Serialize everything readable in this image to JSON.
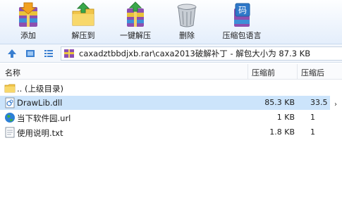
{
  "toolbar": {
    "buttons": [
      {
        "label": "添加",
        "icon": "add-archive-icon"
      },
      {
        "label": "解压到",
        "icon": "extract-to-icon"
      },
      {
        "label": "一键解压",
        "icon": "one-click-extract-icon"
      },
      {
        "label": "删除",
        "icon": "trash-icon"
      },
      {
        "label": "压缩包语言",
        "icon": "archive-language-icon"
      }
    ],
    "language_glyph": "码"
  },
  "address": {
    "path": "caxadztbbdjxb.rar\\caxa2013破解补丁 - 解包大小为 87.3 KB"
  },
  "columns": {
    "name": "名称",
    "size": "压缩前",
    "packed": "压缩后"
  },
  "rows": [
    {
      "name": ".. (上级目录)",
      "size": "",
      "packed": "",
      "icon": "folder-up-icon",
      "selected": false
    },
    {
      "name": "DrawLib.dll",
      "size": "85.3 KB",
      "packed": "33.5",
      "icon": "dll-file-icon",
      "selected": true
    },
    {
      "name": "当下软件园.url",
      "size": "1 KB",
      "packed": "1",
      "icon": "globe-url-icon",
      "selected": false
    },
    {
      "name": "使用说明.txt",
      "size": "1.8 KB",
      "packed": "1",
      "icon": "text-file-icon",
      "selected": false
    }
  ],
  "colors": {
    "selection": "#cce4fb",
    "toolbar_top": "#fdfeff",
    "toolbar_bottom": "#e4eefb"
  }
}
